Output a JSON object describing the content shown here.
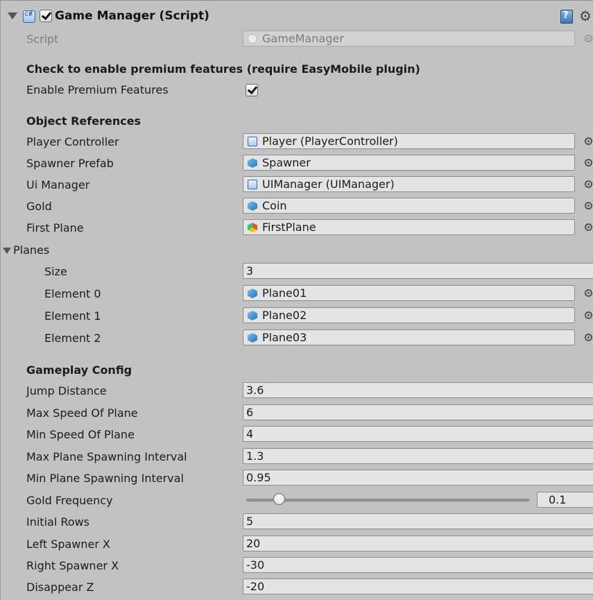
{
  "component": {
    "title": "Game Manager (Script)",
    "script_label": "Script",
    "script_value": "GameManager"
  },
  "premium": {
    "heading": "Check to enable premium features (require EasyMobile plugin)",
    "enable_label": "Enable Premium Features",
    "enabled": true
  },
  "object_references": {
    "heading": "Object References",
    "fields": [
      {
        "label": "Player Controller",
        "value": "Player (PlayerController)",
        "icon": "script-icon"
      },
      {
        "label": "Spawner Prefab",
        "value": "Spawner",
        "icon": "prefab-cube-icon"
      },
      {
        "label": "Ui Manager",
        "value": "UIManager (UIManager)",
        "icon": "script-icon"
      },
      {
        "label": "Gold",
        "value": "Coin",
        "icon": "prefab-cube-icon"
      },
      {
        "label": "First Plane",
        "value": "FirstPlane",
        "icon": "model-prefab-icon"
      }
    ]
  },
  "planes": {
    "label": "Planes",
    "size_label": "Size",
    "size_value": "3",
    "elements": [
      {
        "label": "Element 0",
        "value": "Plane01",
        "icon": "prefab-cube-icon"
      },
      {
        "label": "Element 1",
        "value": "Plane02",
        "icon": "prefab-cube-icon"
      },
      {
        "label": "Element 2",
        "value": "Plane03",
        "icon": "prefab-cube-icon"
      }
    ]
  },
  "gameplay": {
    "heading": "Gameplay Config",
    "fields": [
      {
        "label": "Jump Distance",
        "value": "3.6"
      },
      {
        "label": "Max Speed Of Plane",
        "value": "6"
      },
      {
        "label": "Min Speed Of Plane",
        "value": "4"
      },
      {
        "label": "Max Plane Spawning Interval",
        "value": "1.3"
      },
      {
        "label": "Min Plane Spawning Interval",
        "value": "0.95"
      }
    ],
    "gold_frequency": {
      "label": "Gold Frequency",
      "value": "0.1",
      "slider_fraction": 0.1
    },
    "fields2": [
      {
        "label": "Initial Rows",
        "value": "5"
      },
      {
        "label": "Left Spawner X",
        "value": "20"
      },
      {
        "label": "Right Spawner X",
        "value": "-30"
      },
      {
        "label": "Disappear Z",
        "value": "-20"
      }
    ]
  }
}
